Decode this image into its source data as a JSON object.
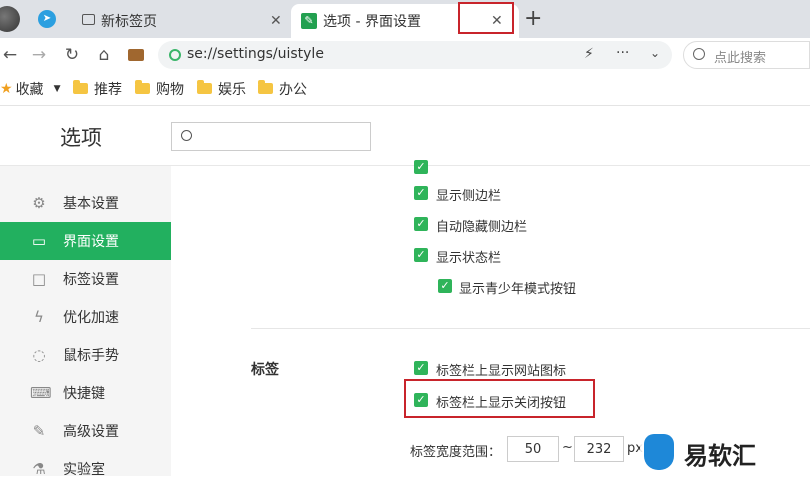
{
  "browser": {
    "tabs": [
      {
        "title": "新标签页",
        "active": false
      },
      {
        "title": "选项 - 界面设置",
        "active": true
      }
    ],
    "new_tab_label": "+",
    "address": "se://settings/uistyle",
    "search_placeholder": "点此搜索",
    "menu_dots": "···"
  },
  "bookmarks": {
    "bar_label": "收藏",
    "items": [
      {
        "label": "推荐"
      },
      {
        "label": "购物"
      },
      {
        "label": "娱乐"
      },
      {
        "label": "办公"
      }
    ]
  },
  "settings": {
    "title": "选项",
    "search_value": ""
  },
  "sidebar": {
    "items": [
      {
        "label": "基本设置",
        "icon": "gear-icon"
      },
      {
        "label": "界面设置",
        "icon": "window-icon",
        "active": true
      },
      {
        "label": "标签设置",
        "icon": "tab-icon"
      },
      {
        "label": "优化加速",
        "icon": "lightning-icon"
      },
      {
        "label": "鼠标手势",
        "icon": "mouse-icon"
      },
      {
        "label": "快捷键",
        "icon": "keyboard-icon"
      },
      {
        "label": "高级设置",
        "icon": "wrench-icon"
      },
      {
        "label": "实验室",
        "icon": "flask-icon"
      }
    ]
  },
  "content": {
    "interface_options": [
      {
        "label": "显示侧边栏",
        "checked": true
      },
      {
        "label": "自动隐藏侧边栏",
        "checked": true
      },
      {
        "label": "显示状态栏",
        "checked": true
      },
      {
        "label": "显示青少年模式按钮",
        "checked": true
      }
    ],
    "tabs_section": {
      "title": "标签",
      "options": [
        {
          "label": "标签栏上显示网站图标",
          "checked": true
        },
        {
          "label": "标签栏上显示关闭按钮",
          "checked": true
        }
      ],
      "width_range_label": "标签宽度范围：",
      "width_min": "50",
      "width_sep": "~",
      "width_max": "232",
      "width_unit": "px"
    }
  },
  "watermark": {
    "text": "易软汇"
  },
  "colors": {
    "accent": "#22b05f",
    "checkbox": "#2fb45a",
    "highlight": "#c8242b"
  }
}
